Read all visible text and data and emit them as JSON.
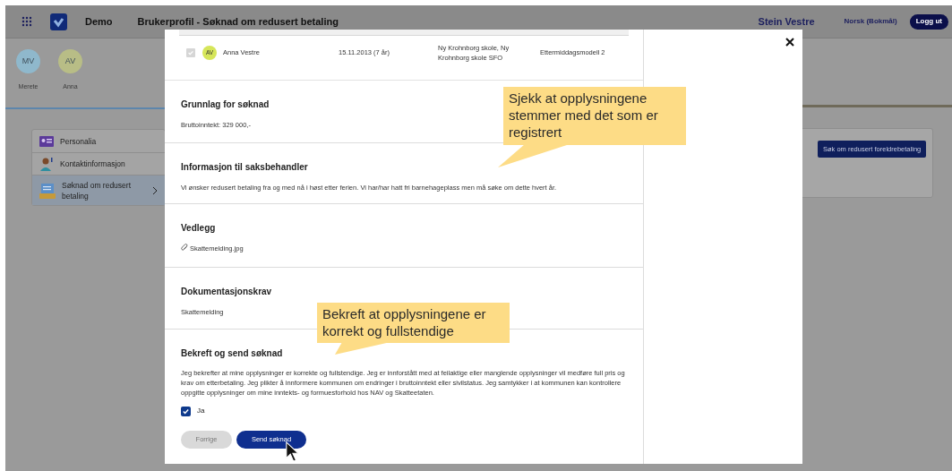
{
  "header": {
    "app_name": "Demo",
    "page_title": "Brukerprofil - Søknad om redusert betaling",
    "user_name": "Stein Vestre",
    "language": "Norsk (Bokmål)",
    "logout": "Logg ut"
  },
  "people": [
    {
      "initials": "MV",
      "name": "Merete",
      "color": "#8fb8cc"
    },
    {
      "initials": "AV",
      "name": "Anna",
      "color": "#b8bd86"
    }
  ],
  "sidebar": {
    "items": [
      {
        "label": "Personalia",
        "selected": false
      },
      {
        "label": "Kontaktinformasjon",
        "selected": false
      },
      {
        "label": "Søknad om redusert betaling",
        "selected": true
      }
    ]
  },
  "apply_button": "Søk om redusert foreldrebetaling",
  "modal": {
    "child_row": {
      "checked": true,
      "initials": "AV",
      "name": "Anna Vestre",
      "birth": "15.11.2013 (7 år)",
      "school": "Ny Krohnborg skole, Ny Krohnborg skole SFO",
      "model": "Ettermiddagsmodell 2"
    },
    "sections": [
      {
        "kind": "text",
        "title": "Grunnlag for søknad",
        "text": "Bruttoinntekt: 329 000,-"
      },
      {
        "kind": "text",
        "title": "Informasjon til saksbehandler",
        "text": "Vi ønsker redusert betaling fra og med nå i høst etter ferien. Vi har/har hatt fri barnehageplass men må søke om dette hvert år."
      },
      {
        "kind": "attachment",
        "title": "Vedlegg",
        "text": "Skattemelding.jpg"
      },
      {
        "kind": "text",
        "title": "Dokumentasjonskrav",
        "text": "Skattemelding"
      },
      {
        "kind": "confirm",
        "title": "Bekreft og send søknad",
        "text": "Jeg bekrefter at mine opplysninger er korrekte og fullstendige. Jeg er innforstått med at feilaktige eller manglende opplysninger vil medføre full pris og krav om etterbetaling. Jeg plikter å innformere kommunen om endringer i bruttoinntekt eller sivilstatus. Jeg samtykker i at kommunen kan kontrollere oppgitte opplysninger om mine inntekts- og formuesforhold hos NAV og Skatteetaten.",
        "checkbox": {
          "label": "Ja",
          "checked": true
        },
        "buttons": [
          {
            "label": "Forrige",
            "kind": "secondary"
          },
          {
            "label": "Send søknad",
            "kind": "primary"
          }
        ]
      }
    ]
  },
  "callouts": [
    {
      "text": "Sjekk at opplysningene stemmer med det som er registrert"
    },
    {
      "text": "Bekreft at opplysningene er korrekt og fullstendige"
    }
  ]
}
